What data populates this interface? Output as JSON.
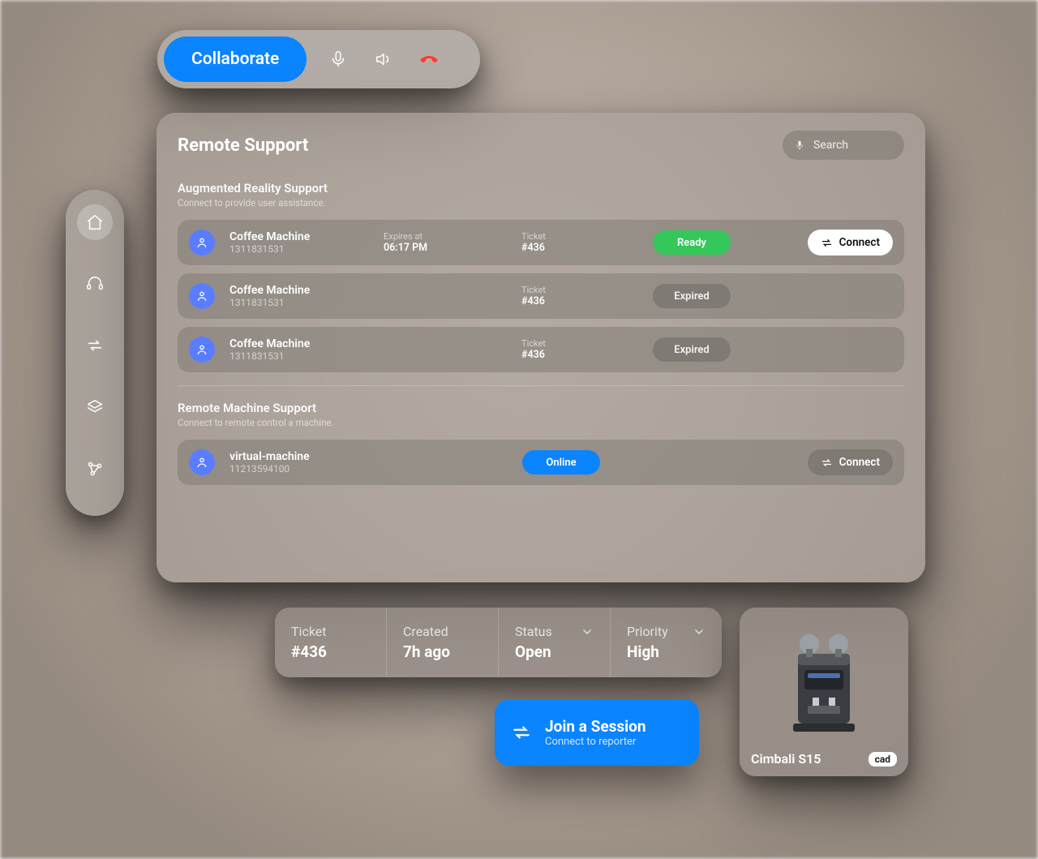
{
  "callbar": {
    "collaborate_label": "Collaborate"
  },
  "sidebar": {
    "items": [
      {
        "name": "home",
        "active": true
      },
      {
        "name": "support"
      },
      {
        "name": "transfer"
      },
      {
        "name": "layers"
      },
      {
        "name": "graph"
      }
    ]
  },
  "panel": {
    "title": "Remote Support",
    "search_placeholder": "Search",
    "ar": {
      "title": "Augmented Reality Support",
      "subtitle": "Connect to provide user assistance.",
      "rows": [
        {
          "name": "Coffee Machine",
          "id": "1311831531",
          "expires_label": "Expires at",
          "expires_value": "06:17 PM",
          "ticket_label": "Ticket",
          "ticket_value": "#436",
          "status": "Ready",
          "action": "Connect"
        },
        {
          "name": "Coffee Machine",
          "id": "1311831531",
          "ticket_label": "Ticket",
          "ticket_value": "#436",
          "status": "Expired"
        },
        {
          "name": "Coffee Machine",
          "id": "1311831531",
          "ticket_label": "Ticket",
          "ticket_value": "#436",
          "status": "Expired"
        }
      ]
    },
    "rm": {
      "title": "Remote Machine Support",
      "subtitle": "Connect to remote control a machine.",
      "rows": [
        {
          "name": "virtual-machine",
          "id": "11213594100",
          "status": "Online",
          "action": "Connect"
        }
      ]
    }
  },
  "ticket": {
    "cells": [
      {
        "label": "Ticket",
        "value": "#436"
      },
      {
        "label": "Created",
        "value": "7h ago"
      },
      {
        "label": "Status",
        "value": "Open",
        "chevron": true
      },
      {
        "label": "Priority",
        "value": "High",
        "chevron": true
      }
    ]
  },
  "join": {
    "title": "Join a Session",
    "subtitle": "Connect to reporter"
  },
  "device": {
    "name": "Cimbali S15",
    "tag": "cad"
  }
}
